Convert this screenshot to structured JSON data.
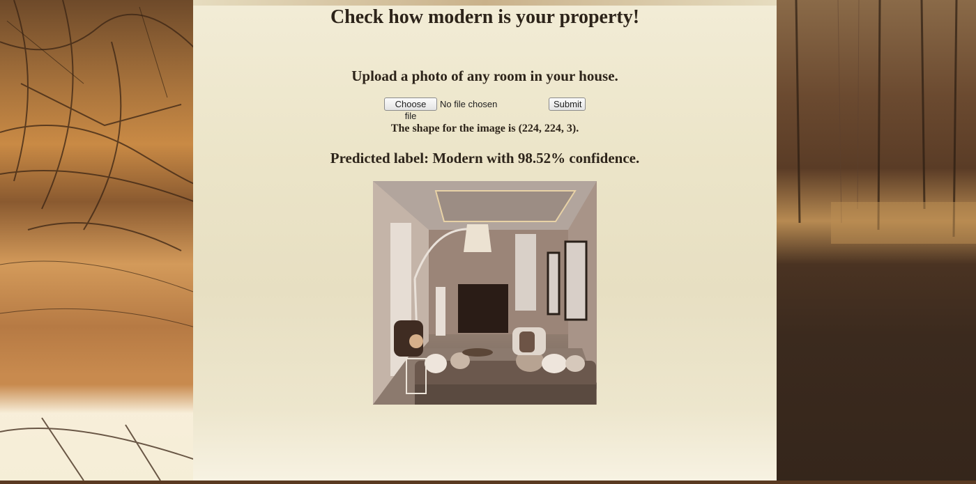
{
  "page": {
    "title": "Check how modern is your property!",
    "subtitle": "Upload a photo of any room in your house."
  },
  "upload": {
    "choose_label": "Choose file",
    "file_status": "No file chosen",
    "submit_label": "Submit"
  },
  "result": {
    "shape_text": "The shape for the image is (224, 224, 3).",
    "prediction_text": "Predicted label: Modern with 98.52% confidence.",
    "image_description": "uploaded-room-photo"
  }
}
